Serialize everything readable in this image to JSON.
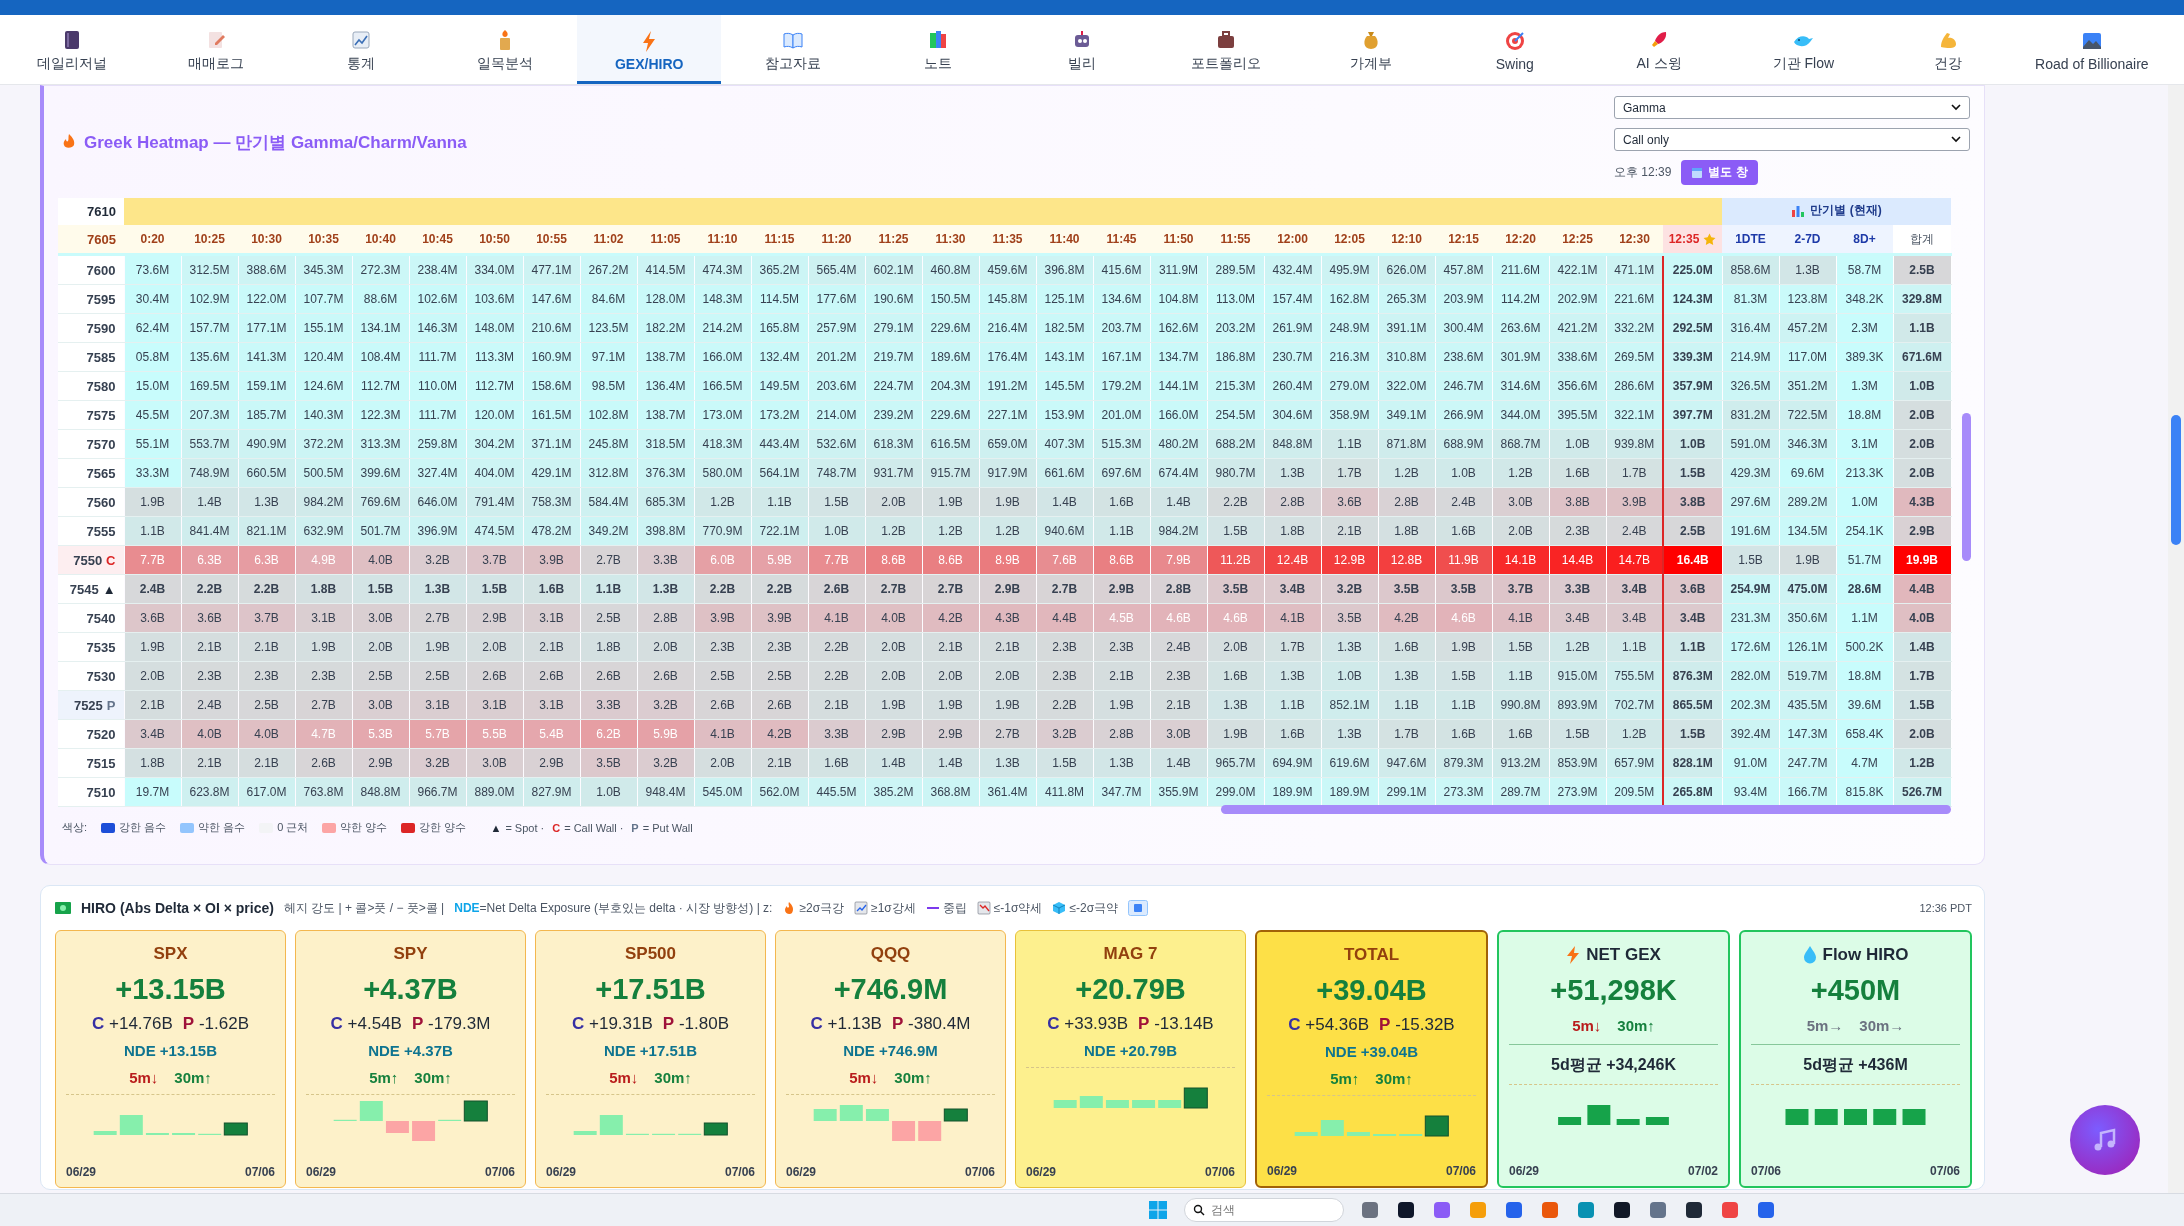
{
  "nav": {
    "tabs": [
      {
        "label": "데일리저널",
        "selected": false
      },
      {
        "label": "매매로그",
        "selected": false
      },
      {
        "label": "통계",
        "selected": false
      },
      {
        "label": "일목분석",
        "selected": false
      },
      {
        "label": "GEX/HIRO",
        "selected": true
      },
      {
        "label": "참고자료",
        "selected": false
      },
      {
        "label": "노트",
        "selected": false
      },
      {
        "label": "빌리",
        "selected": false
      },
      {
        "label": "포트폴리오",
        "selected": false
      },
      {
        "label": "가계부",
        "selected": false
      },
      {
        "label": "Swing",
        "selected": false
      },
      {
        "label": "AI 스윙",
        "selected": false
      },
      {
        "label": "기관 Flow",
        "selected": false
      },
      {
        "label": "건강",
        "selected": false
      },
      {
        "label": "Road of Billionaire",
        "selected": false
      }
    ]
  },
  "heatmap": {
    "title": "Greek Heatmap — 만기별 Gamma/Charm/Vanna",
    "greek_select": {
      "value": "Gamma"
    },
    "filter_select": {
      "value": "Call only"
    },
    "updated": "오후 12:39",
    "popout_button": "별도 창",
    "band_strike": "7610",
    "header_strike": "7605",
    "times": [
      "0:20",
      "10:25",
      "10:30",
      "10:35",
      "10:40",
      "10:45",
      "10:50",
      "10:55",
      "11:02",
      "11:05",
      "11:10",
      "11:15",
      "11:20",
      "11:25",
      "11:30",
      "11:35",
      "11:40",
      "11:45",
      "11:50",
      "11:55",
      "12:00",
      "12:05",
      "12:10",
      "12:15",
      "12:20",
      "12:25",
      "12:30"
    ],
    "current_time": "12:35",
    "expiry_group": "만기별 (현재)",
    "expiry_columns": [
      "1DTE",
      "2-7D",
      "8D+"
    ],
    "total_column": "합계",
    "rows": [
      {
        "strike": "7600",
        "values": [
          "73.6M",
          "312.5M",
          "388.6M",
          "345.3M",
          "272.3M",
          "238.4M",
          "334.0M",
          "477.1M",
          "267.2M",
          "414.5M",
          "474.3M",
          "365.2M",
          "565.4M",
          "602.1M",
          "460.8M",
          "459.6M",
          "396.8M",
          "415.6M",
          "311.9M",
          "289.5M",
          "432.4M",
          "495.9M",
          "626.0M",
          "457.8M",
          "211.6M",
          "422.1M",
          "471.1M"
        ],
        "current": "225.0M",
        "expiry": [
          "858.6M",
          "1.3B",
          "58.7M"
        ],
        "total": "2.5B"
      },
      {
        "strike": "7595",
        "values": [
          "30.4M",
          "102.9M",
          "122.0M",
          "107.7M",
          "88.6M",
          "102.6M",
          "103.6M",
          "147.6M",
          "84.6M",
          "128.0M",
          "148.3M",
          "114.5M",
          "177.6M",
          "190.6M",
          "150.5M",
          "145.8M",
          "125.1M",
          "134.6M",
          "104.8M",
          "113.0M",
          "157.4M",
          "162.8M",
          "265.3M",
          "203.9M",
          "114.2M",
          "202.9M",
          "221.6M"
        ],
        "current": "124.3M",
        "expiry": [
          "81.3M",
          "123.8M",
          "348.2K"
        ],
        "total": "329.8M"
      },
      {
        "strike": "7590",
        "values": [
          "62.4M",
          "157.7M",
          "177.1M",
          "155.1M",
          "134.1M",
          "146.3M",
          "148.0M",
          "210.6M",
          "123.5M",
          "182.2M",
          "214.2M",
          "165.8M",
          "257.9M",
          "279.1M",
          "229.6M",
          "216.4M",
          "182.5M",
          "203.7M",
          "162.6M",
          "203.2M",
          "261.9M",
          "248.9M",
          "391.1M",
          "300.4M",
          "263.6M",
          "421.2M",
          "332.2M"
        ],
        "current": "292.5M",
        "expiry": [
          "316.4M",
          "457.2M",
          "2.3M"
        ],
        "total": "1.1B"
      },
      {
        "strike": "7585",
        "values": [
          "05.8M",
          "135.6M",
          "141.3M",
          "120.4M",
          "108.4M",
          "111.7M",
          "113.3M",
          "160.9M",
          "97.1M",
          "138.7M",
          "166.0M",
          "132.4M",
          "201.2M",
          "219.7M",
          "189.6M",
          "176.4M",
          "143.1M",
          "167.1M",
          "134.7M",
          "186.8M",
          "230.7M",
          "216.3M",
          "310.8M",
          "238.6M",
          "301.9M",
          "338.6M",
          "269.5M"
        ],
        "current": "339.3M",
        "expiry": [
          "214.9M",
          "117.0M",
          "389.3K"
        ],
        "total": "671.6M"
      },
      {
        "strike": "7580",
        "values": [
          "15.0M",
          "169.5M",
          "159.1M",
          "124.6M",
          "112.7M",
          "110.0M",
          "112.7M",
          "158.6M",
          "98.5M",
          "136.4M",
          "166.5M",
          "149.5M",
          "203.6M",
          "224.7M",
          "204.3M",
          "191.2M",
          "145.5M",
          "179.2M",
          "144.1M",
          "215.3M",
          "260.4M",
          "279.0M",
          "322.0M",
          "246.7M",
          "314.6M",
          "356.6M",
          "286.6M"
        ],
        "current": "357.9M",
        "expiry": [
          "326.5M",
          "351.2M",
          "1.3M"
        ],
        "total": "1.0B"
      },
      {
        "strike": "7575",
        "values": [
          "45.5M",
          "207.3M",
          "185.7M",
          "140.3M",
          "122.3M",
          "111.7M",
          "120.0M",
          "161.5M",
          "102.8M",
          "138.7M",
          "173.0M",
          "173.2M",
          "214.0M",
          "239.2M",
          "229.6M",
          "227.1M",
          "153.9M",
          "201.0M",
          "166.0M",
          "254.5M",
          "304.6M",
          "358.9M",
          "349.1M",
          "266.9M",
          "344.0M",
          "395.5M",
          "322.1M"
        ],
        "current": "397.7M",
        "expiry": [
          "831.2M",
          "722.5M",
          "18.8M"
        ],
        "total": "2.0B"
      },
      {
        "strike": "7570",
        "values": [
          "55.1M",
          "553.7M",
          "490.9M",
          "372.2M",
          "313.3M",
          "259.8M",
          "304.2M",
          "371.1M",
          "245.8M",
          "318.5M",
          "418.3M",
          "443.4M",
          "532.6M",
          "618.3M",
          "616.5M",
          "659.0M",
          "407.3M",
          "515.3M",
          "480.2M",
          "688.2M",
          "848.8M",
          "1.1B",
          "871.8M",
          "688.9M",
          "868.7M",
          "1.0B",
          "939.8M"
        ],
        "current": "1.0B",
        "expiry": [
          "591.0M",
          "346.3M",
          "3.1M"
        ],
        "total": "2.0B"
      },
      {
        "strike": "7565",
        "values": [
          "33.3M",
          "748.9M",
          "660.5M",
          "500.5M",
          "399.6M",
          "327.4M",
          "404.0M",
          "429.1M",
          "312.8M",
          "376.3M",
          "580.0M",
          "564.1M",
          "748.7M",
          "931.7M",
          "915.7M",
          "917.9M",
          "661.6M",
          "697.6M",
          "674.4M",
          "980.7M",
          "1.3B",
          "1.7B",
          "1.2B",
          "1.0B",
          "1.2B",
          "1.6B",
          "1.7B"
        ],
        "current": "1.5B",
        "expiry": [
          "429.3M",
          "69.6M",
          "213.3K"
        ],
        "total": "2.0B"
      },
      {
        "strike": "7560",
        "values": [
          "1.9B",
          "1.4B",
          "1.3B",
          "984.2M",
          "769.6M",
          "646.0M",
          "791.4M",
          "758.3M",
          "584.4M",
          "685.3M",
          "1.2B",
          "1.1B",
          "1.5B",
          "2.0B",
          "1.9B",
          "1.9B",
          "1.4B",
          "1.6B",
          "1.4B",
          "2.2B",
          "2.8B",
          "3.6B",
          "2.8B",
          "2.4B",
          "3.0B",
          "3.8B",
          "3.9B"
        ],
        "current": "3.8B",
        "expiry": [
          "297.6M",
          "289.2M",
          "1.0M"
        ],
        "total": "4.3B"
      },
      {
        "strike": "7555",
        "values": [
          "1.1B",
          "841.4M",
          "821.1M",
          "632.9M",
          "501.7M",
          "396.9M",
          "474.5M",
          "478.2M",
          "349.2M",
          "398.8M",
          "770.9M",
          "722.1M",
          "1.0B",
          "1.2B",
          "1.2B",
          "1.2B",
          "940.6M",
          "1.1B",
          "984.2M",
          "1.5B",
          "1.8B",
          "2.1B",
          "1.8B",
          "1.6B",
          "2.0B",
          "2.3B",
          "2.4B"
        ],
        "current": "2.5B",
        "expiry": [
          "191.6M",
          "134.5M",
          "254.1K"
        ],
        "total": "2.9B"
      },
      {
        "strike": "7550",
        "marker": {
          "kind": "call",
          "symbol": "C"
        },
        "values": [
          "7.7B",
          "6.3B",
          "6.3B",
          "4.9B",
          "4.0B",
          "3.2B",
          "3.7B",
          "3.9B",
          "2.7B",
          "3.3B",
          "6.0B",
          "5.9B",
          "7.7B",
          "8.6B",
          "8.6B",
          "8.9B",
          "7.6B",
          "8.6B",
          "7.9B",
          "11.2B",
          "12.4B",
          "12.9B",
          "12.8B",
          "11.9B",
          "14.1B",
          "14.4B",
          "14.7B"
        ],
        "current": "16.4B",
        "expiry": [
          "1.5B",
          "1.9B",
          "51.7M"
        ],
        "total": "19.9B"
      },
      {
        "strike": "7545",
        "marker": {
          "kind": "spot",
          "symbol": "▲"
        },
        "values": [
          "2.4B",
          "2.2B",
          "2.2B",
          "1.8B",
          "1.5B",
          "1.3B",
          "1.5B",
          "1.6B",
          "1.1B",
          "1.3B",
          "2.2B",
          "2.2B",
          "2.6B",
          "2.7B",
          "2.7B",
          "2.9B",
          "2.7B",
          "2.9B",
          "2.8B",
          "3.5B",
          "3.4B",
          "3.2B",
          "3.5B",
          "3.5B",
          "3.7B",
          "3.3B",
          "3.4B"
        ],
        "current": "3.6B",
        "expiry": [
          "254.9M",
          "475.0M",
          "28.6M"
        ],
        "total": "4.4B"
      },
      {
        "strike": "7540",
        "values": [
          "3.6B",
          "3.6B",
          "3.7B",
          "3.1B",
          "3.0B",
          "2.7B",
          "2.9B",
          "3.1B",
          "2.5B",
          "2.8B",
          "3.9B",
          "3.9B",
          "4.1B",
          "4.0B",
          "4.2B",
          "4.3B",
          "4.4B",
          "4.5B",
          "4.6B",
          "4.6B",
          "4.1B",
          "3.5B",
          "4.2B",
          "4.6B",
          "4.1B",
          "3.4B",
          "3.4B"
        ],
        "current": "3.4B",
        "expiry": [
          "231.3M",
          "350.6M",
          "1.1M"
        ],
        "total": "4.0B"
      },
      {
        "strike": "7535",
        "values": [
          "1.9B",
          "2.1B",
          "2.1B",
          "1.9B",
          "2.0B",
          "1.9B",
          "2.0B",
          "2.1B",
          "1.8B",
          "2.0B",
          "2.3B",
          "2.3B",
          "2.2B",
          "2.0B",
          "2.1B",
          "2.1B",
          "2.3B",
          "2.3B",
          "2.4B",
          "2.0B",
          "1.7B",
          "1.3B",
          "1.6B",
          "1.9B",
          "1.5B",
          "1.2B",
          "1.1B"
        ],
        "current": "1.1B",
        "expiry": [
          "172.6M",
          "126.1M",
          "500.2K"
        ],
        "total": "1.4B"
      },
      {
        "strike": "7530",
        "values": [
          "2.0B",
          "2.3B",
          "2.3B",
          "2.3B",
          "2.5B",
          "2.5B",
          "2.6B",
          "2.6B",
          "2.6B",
          "2.6B",
          "2.5B",
          "2.5B",
          "2.2B",
          "2.0B",
          "2.0B",
          "2.0B",
          "2.3B",
          "2.1B",
          "2.3B",
          "1.6B",
          "1.3B",
          "1.0B",
          "1.3B",
          "1.5B",
          "1.1B",
          "915.0M",
          "755.5M"
        ],
        "current": "876.3M",
        "expiry": [
          "282.0M",
          "519.7M",
          "18.8M"
        ],
        "total": "1.7B"
      },
      {
        "strike": "7525",
        "marker": {
          "kind": "put",
          "symbol": "P"
        },
        "values": [
          "2.1B",
          "2.4B",
          "2.5B",
          "2.7B",
          "3.0B",
          "3.1B",
          "3.1B",
          "3.1B",
          "3.3B",
          "3.2B",
          "2.6B",
          "2.6B",
          "2.1B",
          "1.9B",
          "1.9B",
          "1.9B",
          "2.2B",
          "1.9B",
          "2.1B",
          "1.3B",
          "1.1B",
          "852.1M",
          "1.1B",
          "1.1B",
          "990.8M",
          "893.9M",
          "702.7M"
        ],
        "current": "865.5M",
        "expiry": [
          "202.3M",
          "435.5M",
          "39.6M"
        ],
        "total": "1.5B"
      },
      {
        "strike": "7520",
        "values": [
          "3.4B",
          "4.0B",
          "4.0B",
          "4.7B",
          "5.3B",
          "5.7B",
          "5.5B",
          "5.4B",
          "6.2B",
          "5.9B",
          "4.1B",
          "4.2B",
          "3.3B",
          "2.9B",
          "2.9B",
          "2.7B",
          "3.2B",
          "2.8B",
          "3.0B",
          "1.9B",
          "1.6B",
          "1.3B",
          "1.7B",
          "1.6B",
          "1.6B",
          "1.5B",
          "1.2B"
        ],
        "current": "1.5B",
        "expiry": [
          "392.4M",
          "147.3M",
          "658.4K"
        ],
        "total": "2.0B"
      },
      {
        "strike": "7515",
        "values": [
          "1.8B",
          "2.1B",
          "2.1B",
          "2.6B",
          "2.9B",
          "3.2B",
          "3.0B",
          "2.9B",
          "3.5B",
          "3.2B",
          "2.0B",
          "2.1B",
          "1.6B",
          "1.4B",
          "1.4B",
          "1.3B",
          "1.5B",
          "1.3B",
          "1.4B",
          "965.7M",
          "694.9M",
          "619.6M",
          "947.6M",
          "879.3M",
          "913.2M",
          "853.9M",
          "657.9M"
        ],
        "current": "828.1M",
        "expiry": [
          "91.0M",
          "247.7M",
          "4.7M"
        ],
        "total": "1.2B"
      },
      {
        "strike": "7510",
        "values": [
          "19.7M",
          "623.8M",
          "617.0M",
          "763.8M",
          "848.8M",
          "966.7M",
          "889.0M",
          "827.9M",
          "1.0B",
          "948.4M",
          "545.0M",
          "562.0M",
          "445.5M",
          "385.2M",
          "368.8M",
          "361.4M",
          "411.8M",
          "347.7M",
          "355.9M",
          "299.0M",
          "189.9M",
          "189.9M",
          "299.1M",
          "273.3M",
          "289.7M",
          "273.9M",
          "209.5M"
        ],
        "current": "265.8M",
        "expiry": [
          "93.4M",
          "166.7M",
          "815.8K"
        ],
        "total": "526.7M"
      }
    ],
    "legend": {
      "label": "색상:",
      "items": [
        {
          "label": "강한 음수",
          "color": "#1d4ed8"
        },
        {
          "label": "약한 음수",
          "color": "#93c5fd"
        },
        {
          "label": "0 근처",
          "color": "#f3f4f6"
        },
        {
          "label": "약한 양수",
          "color": "#fca5a5"
        },
        {
          "label": "강한 양수",
          "color": "#dc2626"
        }
      ],
      "marks": [
        {
          "kind": "spot",
          "symbol": "▲",
          "label": "= Spot ·"
        },
        {
          "kind": "call",
          "symbol": "C",
          "label": "= Call Wall ·"
        },
        {
          "kind": "put",
          "symbol": "P",
          "label": "= Put Wall"
        }
      ]
    }
  },
  "hiro": {
    "title": "HIRO (Abs Delta × OI × price)",
    "hedge_note": "헤지 강도 | + 콜>풋 / − 풋>콜 |",
    "nde_note": "**NDE**=Net Delta Exposure (부호있는 delta · 시장 방향성) | z:",
    "z_levels": [
      "≥2σ극강",
      "≥1σ강세",
      "중립",
      "≤-1σ약세",
      "≤-2σ극약"
    ],
    "time": "12:36 PDT",
    "cards": [
      {
        "kind": "index",
        "title": "SPX",
        "value": "+13.15B",
        "legs": [
          {
            "kind": "call",
            "label": "C",
            "value": "+14.76B"
          },
          {
            "kind": "put",
            "label": "P",
            "value": "-1.62B"
          }
        ],
        "nde": "NDE +13.15B",
        "trends": [
          {
            "text": "5m↓",
            "kind": "down"
          },
          {
            "text": "30m↑",
            "kind": "up"
          }
        ],
        "start": "06/29",
        "end": "07/06"
      },
      {
        "kind": "index",
        "title": "SPY",
        "value": "+4.37B",
        "legs": [
          {
            "kind": "call",
            "label": "C",
            "value": "+4.54B"
          },
          {
            "kind": "put",
            "label": "P",
            "value": "-179.3M"
          }
        ],
        "nde": "NDE +4.37B",
        "trends": [
          {
            "text": "5m↑",
            "kind": "up"
          },
          {
            "text": "30m↑",
            "kind": "up"
          }
        ],
        "start": "06/29",
        "end": "07/06"
      },
      {
        "kind": "index",
        "title": "SP500",
        "value": "+17.51B",
        "legs": [
          {
            "kind": "call",
            "label": "C",
            "value": "+19.31B"
          },
          {
            "kind": "put",
            "label": "P",
            "value": "-1.80B"
          }
        ],
        "nde": "NDE +17.51B",
        "trends": [
          {
            "text": "5m↓",
            "kind": "down"
          },
          {
            "text": "30m↑",
            "kind": "up"
          }
        ],
        "start": "06/29",
        "end": "07/06"
      },
      {
        "kind": "index",
        "title": "QQQ",
        "value": "+746.9M",
        "legs": [
          {
            "kind": "call",
            "label": "C",
            "value": "+1.13B"
          },
          {
            "kind": "put",
            "label": "P",
            "value": "-380.4M"
          }
        ],
        "nde": "NDE +746.9M",
        "trends": [
          {
            "text": "5m↓",
            "kind": "down"
          },
          {
            "text": "30m↑",
            "kind": "up"
          }
        ],
        "start": "06/29",
        "end": "07/06"
      },
      {
        "kind": "mag7",
        "title": "MAG 7",
        "value": "+20.79B",
        "legs": [
          {
            "kind": "call",
            "label": "C",
            "value": "+33.93B"
          },
          {
            "kind": "put",
            "label": "P",
            "value": "-13.14B"
          }
        ],
        "nde": "NDE +20.79B",
        "start": "06/29",
        "end": "07/06"
      },
      {
        "kind": "total",
        "title": "TOTAL",
        "value": "+39.04B",
        "legs": [
          {
            "kind": "call",
            "label": "C",
            "value": "+54.36B"
          },
          {
            "kind": "put",
            "label": "P",
            "value": "-15.32B"
          }
        ],
        "nde": "NDE +39.04B",
        "trends": [
          {
            "text": "5m↑",
            "kind": "up"
          },
          {
            "text": "30m↑",
            "kind": "up"
          }
        ],
        "start": "06/29",
        "end": "07/06"
      },
      {
        "kind": "flow",
        "title": "NET GEX",
        "value": "+51,298K",
        "trends": [
          {
            "text": "5m↓",
            "kind": "down"
          },
          {
            "text": "30m↑",
            "kind": "up"
          }
        ],
        "average": "5d평균 +34,246K",
        "start": "06/29",
        "end": "07/02"
      },
      {
        "kind": "flow",
        "title": "Flow HIRO",
        "value": "+450M",
        "trends": [
          {
            "text": "5m→",
            "kind": "flat"
          },
          {
            "text": "30m→",
            "kind": "flat"
          }
        ],
        "average": "5d평균 +436M",
        "start": "07/06",
        "end": "07/06"
      }
    ]
  },
  "taskbar": {
    "search": {
      "placeholder": "검색"
    }
  }
}
